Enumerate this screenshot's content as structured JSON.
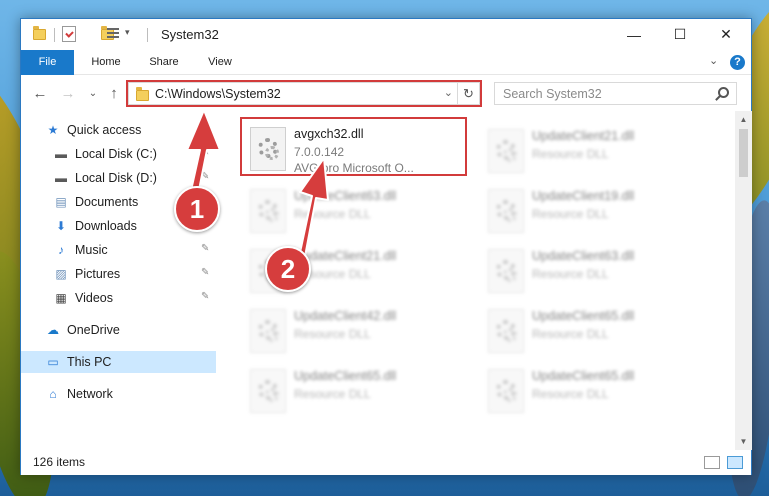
{
  "window": {
    "title": "System32",
    "controls": {
      "minimize": "—",
      "maximize": "☐",
      "close": "✕"
    }
  },
  "ribbon": {
    "tabs": [
      {
        "label": "File",
        "active": true
      },
      {
        "label": "Home"
      },
      {
        "label": "Share"
      },
      {
        "label": "View"
      }
    ],
    "help": "?"
  },
  "navigation": {
    "back": "←",
    "forward": "→",
    "recent": "⌄",
    "up": "↑",
    "address": "C:\\Windows\\System32",
    "search_placeholder": "Search System32",
    "refresh": "↻"
  },
  "sidebar": {
    "items": [
      {
        "label": "Quick access",
        "icon": "star-icon",
        "glyph": "★",
        "color": "#2d7bd4",
        "pinned": false
      },
      {
        "label": "Local Disk (C:)",
        "icon": "drive-icon",
        "glyph": "▬",
        "color": "#5a5a5a",
        "pinned": true
      },
      {
        "label": "Local Disk (D:)",
        "icon": "drive-icon",
        "glyph": "▬",
        "color": "#5a5a5a",
        "pinned": true
      },
      {
        "label": "Documents",
        "icon": "documents-icon",
        "glyph": "▤",
        "color": "#6b8fb8",
        "pinned": true
      },
      {
        "label": "Downloads",
        "icon": "download-icon",
        "glyph": "⬇",
        "color": "#2d7bd4",
        "pinned": true
      },
      {
        "label": "Music",
        "icon": "music-icon",
        "glyph": "♪",
        "color": "#2d7bd4",
        "pinned": true
      },
      {
        "label": "Pictures",
        "icon": "pictures-icon",
        "glyph": "▨",
        "color": "#6b8fb8",
        "pinned": true
      },
      {
        "label": "Videos",
        "icon": "videos-icon",
        "glyph": "▦",
        "color": "#444",
        "pinned": true
      },
      {
        "label": "OneDrive",
        "icon": "cloud-icon",
        "glyph": "☁",
        "color": "#1979ca",
        "pinned": false
      },
      {
        "label": "This PC",
        "icon": "computer-icon",
        "glyph": "▭",
        "color": "#2d7bd4",
        "pinned": false,
        "selected": true
      },
      {
        "label": "Network",
        "icon": "network-icon",
        "glyph": "⌂",
        "color": "#2d7bd4",
        "pinned": false
      }
    ],
    "pin_glyph": "📌"
  },
  "files": [
    {
      "name": "avgxch32.dll",
      "version": "7.0.0.142",
      "description": "AVG pro Microsoft O...",
      "highlighted": true
    },
    {
      "name": "UpdateClient21.dll",
      "description": "Resource DLL"
    },
    {
      "name": "UpdateClient63.dll",
      "description": "Resource DLL"
    },
    {
      "name": "UpdateClient19.dll",
      "description": "Resource DLL"
    },
    {
      "name": "UpdateClient21.dll",
      "description": "Resource DLL"
    },
    {
      "name": "UpdateClient63.dll",
      "description": "Resource DLL"
    },
    {
      "name": "UpdateClient42.dll",
      "description": "Resource DLL"
    },
    {
      "name": "UpdateClient65.dll",
      "description": "Resource DLL"
    },
    {
      "name": "UpdateClient65.dll",
      "description": "Resource DLL"
    },
    {
      "name": "UpdateClient65.dll",
      "description": "Resource DLL"
    }
  ],
  "status": {
    "item_count": "126 items"
  },
  "annotations": {
    "step1": "1",
    "step2": "2",
    "highlight_color": "#d23b3b"
  },
  "colors": {
    "accent": "#1979ca",
    "selected": "#cce8ff"
  }
}
